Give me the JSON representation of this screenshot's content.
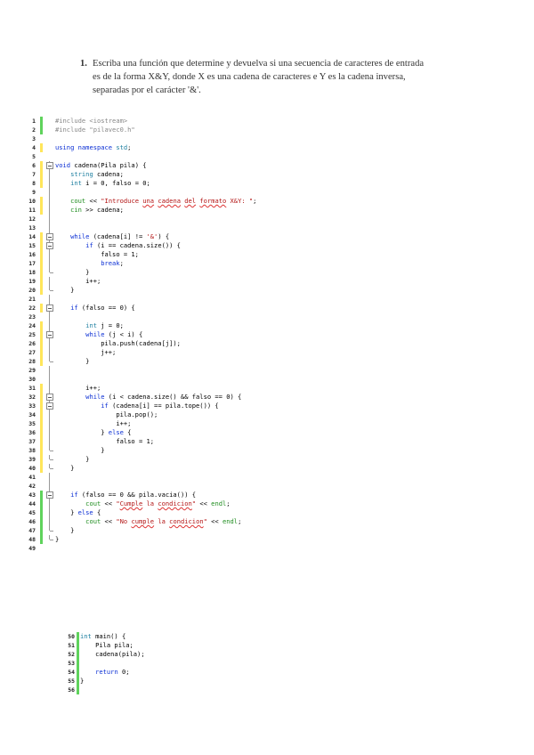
{
  "problem": {
    "number": "1.",
    "lines": [
      "Escriba una función que determine y devuelva si una secuencia de caracteres de entrada",
      "es de la forma X&Y, donde X es una cadena de caracteres e Y es la cadena inversa,",
      "separadas por el carácter '&'."
    ]
  },
  "code": [
    {
      "n": "1",
      "bar": "green",
      "text": "#include <iostream>"
    },
    {
      "n": "2",
      "bar": "green",
      "text": "#include \"pilavec0.h\""
    },
    {
      "n": "3",
      "bar": "",
      "text": ""
    },
    {
      "n": "4",
      "bar": "yellow",
      "text": "using namespace std;"
    },
    {
      "n": "5",
      "bar": "",
      "text": ""
    },
    {
      "n": "6",
      "bar": "yellow",
      "fold": "open",
      "text": "void cadena(Pila pila) {"
    },
    {
      "n": "7",
      "bar": "yellow",
      "fold": "line",
      "text": "    string cadena;"
    },
    {
      "n": "8",
      "bar": "yellow",
      "fold": "line",
      "text": "    int i = 0, falso = 0;"
    },
    {
      "n": "9",
      "bar": "",
      "fold": "line",
      "text": ""
    },
    {
      "n": "10",
      "bar": "yellow",
      "fold": "line",
      "text": "    cout << \"Introduce una cadena del formato X&Y: \";"
    },
    {
      "n": "11",
      "bar": "yellow",
      "fold": "line",
      "text": "    cin >> cadena;"
    },
    {
      "n": "12",
      "bar": "",
      "fold": "line",
      "text": ""
    },
    {
      "n": "13",
      "bar": "",
      "fold": "line",
      "text": ""
    },
    {
      "n": "14",
      "bar": "yellow",
      "fold": "open",
      "text": "    while (cadena[i] != '&') {"
    },
    {
      "n": "15",
      "bar": "yellow",
      "fold": "open",
      "text": "        if (i == cadena.size()) {"
    },
    {
      "n": "16",
      "bar": "yellow",
      "fold": "line",
      "text": "            falso = 1;"
    },
    {
      "n": "17",
      "bar": "yellow",
      "fold": "line",
      "text": "            break;"
    },
    {
      "n": "18",
      "bar": "yellow",
      "fold": "end",
      "text": "        }"
    },
    {
      "n": "19",
      "bar": "yellow",
      "fold": "line",
      "text": "        i++;"
    },
    {
      "n": "20",
      "bar": "yellow",
      "fold": "end",
      "text": "    }"
    },
    {
      "n": "21",
      "bar": "",
      "fold": "line",
      "text": ""
    },
    {
      "n": "22",
      "bar": "yellow",
      "fold": "open",
      "text": "    if (falso == 0) {"
    },
    {
      "n": "23",
      "bar": "",
      "fold": "line",
      "text": ""
    },
    {
      "n": "24",
      "bar": "yellow",
      "fold": "line",
      "text": "        int j = 0;"
    },
    {
      "n": "25",
      "bar": "yellow",
      "fold": "open",
      "text": "        while (j < i) {"
    },
    {
      "n": "26",
      "bar": "yellow",
      "fold": "line",
      "text": "            pila.push(cadena[j]);"
    },
    {
      "n": "27",
      "bar": "yellow",
      "fold": "line",
      "text": "            j++;"
    },
    {
      "n": "28",
      "bar": "yellow",
      "fold": "end",
      "text": "        }"
    },
    {
      "n": "29",
      "bar": "",
      "fold": "line",
      "text": ""
    },
    {
      "n": "30",
      "bar": "",
      "fold": "line",
      "text": ""
    },
    {
      "n": "31",
      "bar": "yellow",
      "fold": "line",
      "text": "        i++;"
    },
    {
      "n": "32",
      "bar": "yellow",
      "fold": "open",
      "text": "        while (i < cadena.size() && falso == 0) {"
    },
    {
      "n": "33",
      "bar": "yellow",
      "fold": "open",
      "text": "            if (cadena[i] == pila.tope()) {"
    },
    {
      "n": "34",
      "bar": "yellow",
      "fold": "line",
      "text": "                pila.pop();"
    },
    {
      "n": "35",
      "bar": "yellow",
      "fold": "line",
      "text": "                i++;"
    },
    {
      "n": "36",
      "bar": "yellow",
      "fold": "line",
      "text": "            } else {"
    },
    {
      "n": "37",
      "bar": "yellow",
      "fold": "line",
      "text": "                falso = 1;"
    },
    {
      "n": "38",
      "bar": "yellow",
      "fold": "end",
      "text": "            }"
    },
    {
      "n": "39",
      "bar": "yellow",
      "fold": "end",
      "text": "        }"
    },
    {
      "n": "40",
      "bar": "yellow",
      "fold": "end",
      "text": "    }"
    },
    {
      "n": "41",
      "bar": "",
      "fold": "line",
      "text": ""
    },
    {
      "n": "42",
      "bar": "",
      "fold": "line",
      "text": ""
    },
    {
      "n": "43",
      "bar": "green",
      "fold": "open",
      "text": "    if (falso == 0 && pila.vacia()) {"
    },
    {
      "n": "44",
      "bar": "green",
      "fold": "line",
      "text": "        cout << \"Cumple la condicion\" << endl;"
    },
    {
      "n": "45",
      "bar": "green",
      "fold": "line",
      "text": "    } else {"
    },
    {
      "n": "46",
      "bar": "green",
      "fold": "line",
      "text": "        cout << \"No cumple la condicion\" << endl;"
    },
    {
      "n": "47",
      "bar": "green",
      "fold": "end",
      "text": "    }"
    },
    {
      "n": "48",
      "bar": "green",
      "fold": "end",
      "text": "}"
    },
    {
      "n": "49",
      "bar": "",
      "text": ""
    }
  ],
  "code2": [
    {
      "n": "50",
      "bar": "green",
      "text": "int main() {"
    },
    {
      "n": "51",
      "bar": "green",
      "text": "    Pila pila;"
    },
    {
      "n": "52",
      "bar": "green",
      "text": "    cadena(pila);"
    },
    {
      "n": "53",
      "bar": "green",
      "text": ""
    },
    {
      "n": "54",
      "bar": "green",
      "text": "    return 0;"
    },
    {
      "n": "55",
      "bar": "green",
      "text": "}"
    },
    {
      "n": "56",
      "bar": "green",
      "text": ""
    }
  ]
}
